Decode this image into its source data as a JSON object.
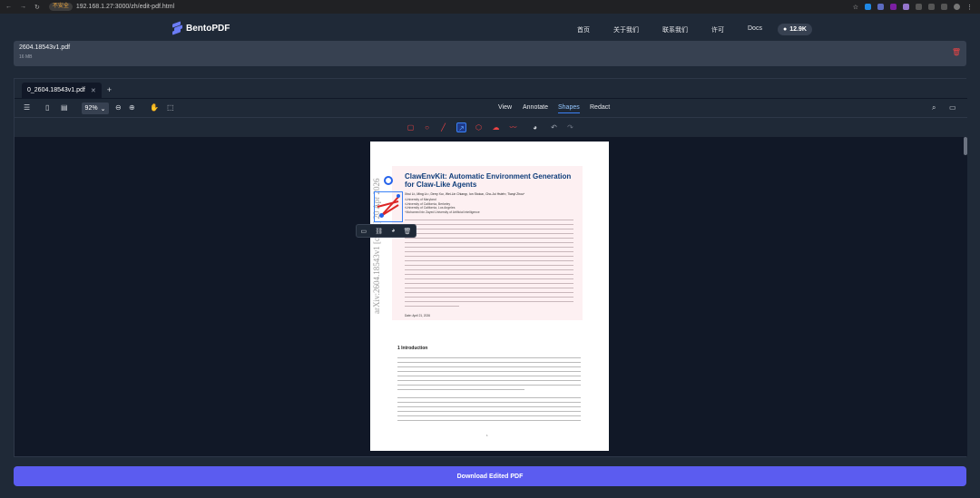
{
  "browser": {
    "security_label": "不安全",
    "url": "192.168.1.27:3000/zh/edit-pdf.html"
  },
  "site": {
    "brand": "BentoPDF",
    "nav": [
      "首页",
      "关于我们",
      "联系我们",
      "许可",
      "Docs"
    ],
    "github_stars": "12.9K"
  },
  "file": {
    "name": "2604.18543v1.pdf",
    "size": "16 MB"
  },
  "editor": {
    "tab_label": "0_2604.18543v1.pdf",
    "zoom": "92%",
    "modes": [
      "View",
      "Annotate",
      "Shapes",
      "Redact"
    ],
    "active_mode": "Shapes"
  },
  "pdf": {
    "title": "ClawEnvKit: Automatic Environment Generation for Claw-Like Agents",
    "arxiv_stamp": "arXiv:2604.18543v1  [cs.AI]  20 Apr 2026",
    "authors": "Xirui Li¹, Ming Li¹², Derry Xu², Wei-Lin Chiang², Ion Stoica², Cho-Jui Hsieh³, Tianyi Zhou⁴",
    "affiliations": [
      "¹University of Maryland",
      "²University of California, Berkeley",
      "³University of California, Los Angeles",
      "⁴Mohamed bin Zayed University of Artificial Intelligence"
    ],
    "date": "Date: April 21, 2026",
    "section": "1   Introduction"
  },
  "actions": {
    "download_label": "Download Edited PDF"
  },
  "colors": {
    "accent": "#5b5cf0",
    "shape_selected": "#3b82f6",
    "danger": "#ef4444"
  }
}
